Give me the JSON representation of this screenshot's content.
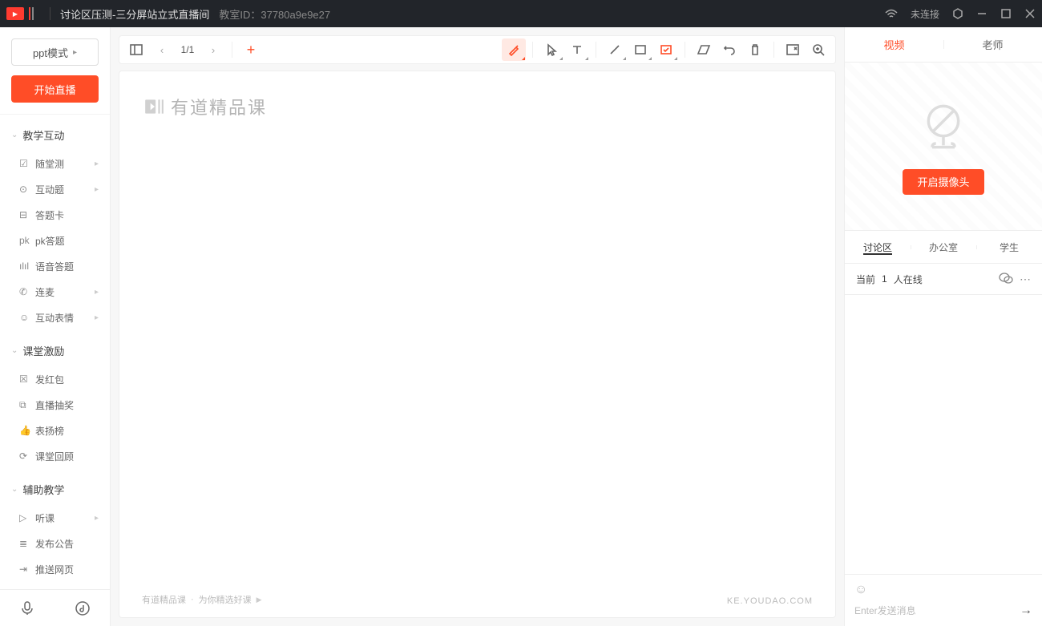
{
  "titlebar": {
    "title": "讨论区压测-三分屏站立式直播间",
    "room_id_label": "教室ID：",
    "room_id": "37780a9e9e27",
    "connection": "未连接"
  },
  "sidebar": {
    "ppt_mode": "ppt模式",
    "start_live": "开始直播",
    "groups": [
      {
        "title": "教学互动",
        "items": [
          {
            "icon": "☑",
            "label": "随堂测",
            "arrow": true
          },
          {
            "icon": "⊙",
            "label": "互动题",
            "arrow": true
          },
          {
            "icon": "⊟",
            "label": "答题卡",
            "arrow": false
          },
          {
            "icon": "pk",
            "label": "pk答题",
            "arrow": false
          },
          {
            "icon": "ılıl",
            "label": "语音答题",
            "arrow": false
          },
          {
            "icon": "✆",
            "label": "连麦",
            "arrow": true
          },
          {
            "icon": "☺",
            "label": "互动表情",
            "arrow": true
          }
        ]
      },
      {
        "title": "课堂激励",
        "items": [
          {
            "icon": "☒",
            "label": "发红包",
            "arrow": false
          },
          {
            "icon": "⧉",
            "label": "直播抽奖",
            "arrow": false
          },
          {
            "icon": "👍",
            "label": "表扬榜",
            "arrow": false
          },
          {
            "icon": "⟳",
            "label": "课堂回顾",
            "arrow": false
          }
        ]
      },
      {
        "title": "辅助教学",
        "items": [
          {
            "icon": "▷",
            "label": "听课",
            "arrow": true
          },
          {
            "icon": "≣",
            "label": "发布公告",
            "arrow": false
          },
          {
            "icon": "⇥",
            "label": "推送网页",
            "arrow": false
          }
        ]
      }
    ]
  },
  "toolbar": {
    "page": "1/1"
  },
  "canvas": {
    "brand": "有道精品课",
    "footer_brand": "有道精品课",
    "footer_tag": "为你精选好课",
    "url": "KE.YOUDAO.COM"
  },
  "right": {
    "tabs": {
      "video": "视频",
      "teacher": "老师"
    },
    "cam_button": "开启摄像头",
    "chat_tabs": {
      "discuss": "讨论区",
      "office": "办公室",
      "student": "学生"
    },
    "online_prefix": "当前",
    "online_count": "1",
    "online_suffix": "人在线",
    "input_placeholder": "Enter发送消息"
  }
}
